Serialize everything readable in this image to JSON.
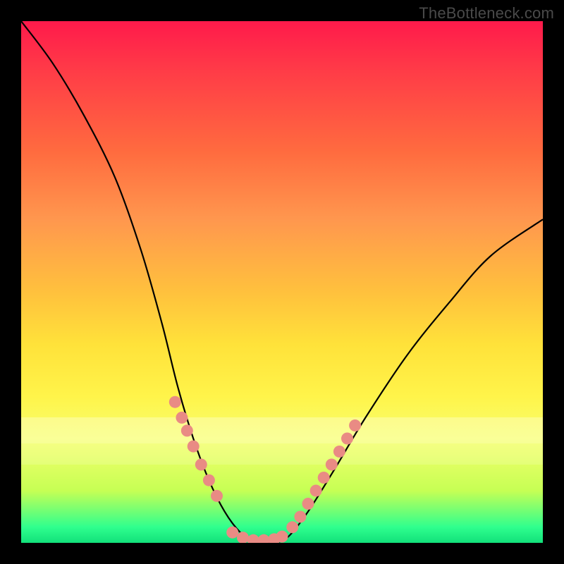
{
  "watermark": "TheBottleneck.com",
  "colors": {
    "frame": "#000000",
    "curve_stroke": "#000000",
    "marker_fill": "#e98b84",
    "marker_stroke": "#c76a63"
  },
  "chart_data": {
    "type": "line",
    "title": "",
    "xlabel": "",
    "ylabel": "",
    "xlim": [
      0,
      100
    ],
    "ylim": [
      0,
      100
    ],
    "grid": false,
    "legend": false,
    "curve": [
      {
        "x": 0,
        "y": 100
      },
      {
        "x": 6,
        "y": 92
      },
      {
        "x": 12,
        "y": 82
      },
      {
        "x": 18,
        "y": 70
      },
      {
        "x": 23,
        "y": 56
      },
      {
        "x": 27,
        "y": 42
      },
      {
        "x": 30,
        "y": 30
      },
      {
        "x": 33,
        "y": 20
      },
      {
        "x": 36,
        "y": 12
      },
      {
        "x": 39,
        "y": 6
      },
      {
        "x": 42,
        "y": 2
      },
      {
        "x": 45,
        "y": 0
      },
      {
        "x": 48,
        "y": 0
      },
      {
        "x": 51,
        "y": 1
      },
      {
        "x": 55,
        "y": 6
      },
      {
        "x": 60,
        "y": 14
      },
      {
        "x": 66,
        "y": 24
      },
      {
        "x": 74,
        "y": 36
      },
      {
        "x": 82,
        "y": 46
      },
      {
        "x": 90,
        "y": 55
      },
      {
        "x": 100,
        "y": 62
      }
    ],
    "markers_left": [
      {
        "x": 29.5,
        "y": 27
      },
      {
        "x": 30.8,
        "y": 24
      },
      {
        "x": 31.8,
        "y": 21.5
      },
      {
        "x": 33.0,
        "y": 18.5
      },
      {
        "x": 34.5,
        "y": 15
      },
      {
        "x": 36.0,
        "y": 12
      },
      {
        "x": 37.5,
        "y": 9
      }
    ],
    "markers_right": [
      {
        "x": 52.0,
        "y": 3
      },
      {
        "x": 53.5,
        "y": 5
      },
      {
        "x": 55.0,
        "y": 7.5
      },
      {
        "x": 56.5,
        "y": 10
      },
      {
        "x": 58.0,
        "y": 12.5
      },
      {
        "x": 59.5,
        "y": 15
      },
      {
        "x": 61.0,
        "y": 17.5
      },
      {
        "x": 62.5,
        "y": 20
      },
      {
        "x": 64.0,
        "y": 22.5
      }
    ],
    "markers_bottom": [
      {
        "x": 40.5,
        "y": 2
      },
      {
        "x": 42.5,
        "y": 1
      },
      {
        "x": 44.5,
        "y": 0.5
      },
      {
        "x": 46.5,
        "y": 0.5
      },
      {
        "x": 48.5,
        "y": 0.7
      },
      {
        "x": 50.0,
        "y": 1.2
      }
    ]
  }
}
